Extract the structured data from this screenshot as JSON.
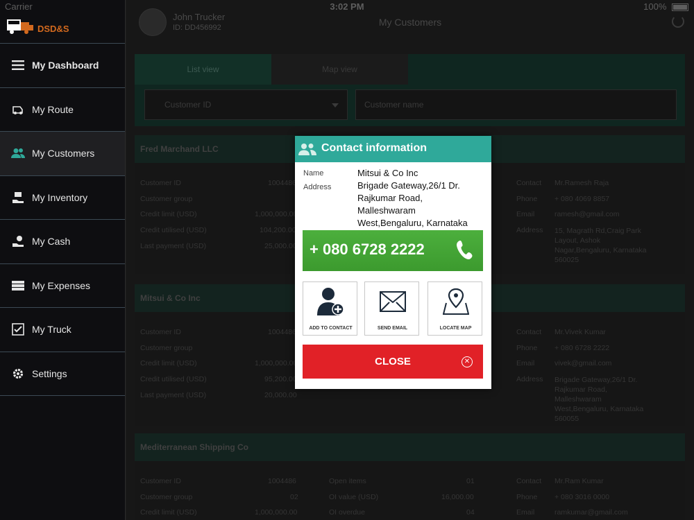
{
  "status_bar": {
    "carrier": "Carrier",
    "time": "3:02 PM",
    "battery": "100%"
  },
  "brand": {
    "name": "DSD&S"
  },
  "sidebar": {
    "items": [
      {
        "label": "My Dashboard",
        "icon": "menu-icon"
      },
      {
        "label": "My Route",
        "icon": "route-icon"
      },
      {
        "label": "My Customers",
        "icon": "customers-icon",
        "active": true
      },
      {
        "label": "My Inventory",
        "icon": "inventory-icon"
      },
      {
        "label": "My Cash",
        "icon": "cash-icon"
      },
      {
        "label": "My Expenses",
        "icon": "expenses-icon"
      },
      {
        "label": "My Truck",
        "icon": "truck-check-icon"
      },
      {
        "label": "Settings",
        "icon": "gear-icon"
      }
    ]
  },
  "header": {
    "user_name": "John Trucker",
    "user_id": "ID: DD456992",
    "title": "My Customers"
  },
  "tabs": [
    {
      "label": "List view"
    },
    {
      "label": "Map view"
    }
  ],
  "filters": {
    "select_placeholder": "Customer ID",
    "search_placeholder": "Customer name"
  },
  "customers": [
    {
      "name": "Fred Marchand LLC",
      "col1": [
        {
          "k": "Customer ID",
          "v": "1004486"
        },
        {
          "k": "Customer group",
          "v": "02"
        },
        {
          "k": "Credit limit (USD)",
          "v": "1,000,000.00"
        },
        {
          "k": "Credit utilised (USD)",
          "v": "104,200.00"
        },
        {
          "k": "Last payment (USD)",
          "v": "25,000.00"
        }
      ],
      "col3": [
        {
          "k": "Contact",
          "v": "Mr.Ramesh Raja"
        },
        {
          "k": "Phone",
          "v": "+ 080 4069 8857"
        },
        {
          "k": "Email",
          "v": "ramesh@gmail.com"
        },
        {
          "k": "Address",
          "v": "15, Magrath Rd,Craig Park Layout, Ashok Nagar,Bengaluru, Karnataka 560025"
        }
      ]
    },
    {
      "name": "Mitsui & Co Inc",
      "col1": [
        {
          "k": "Customer ID",
          "v": "1004486"
        },
        {
          "k": "Customer group",
          "v": "02"
        },
        {
          "k": "Credit limit (USD)",
          "v": "1,000,000.00"
        },
        {
          "k": "Credit utilised (USD)",
          "v": "95,200.00"
        },
        {
          "k": "Last payment (USD)",
          "v": "20,000.00"
        }
      ],
      "col3": [
        {
          "k": "Contact",
          "v": "Mr.Vivek Kumar"
        },
        {
          "k": "Phone",
          "v": "+ 080 6728 2222"
        },
        {
          "k": "Email",
          "v": "vivek@gmail.com"
        },
        {
          "k": "Address",
          "v": "Brigade Gateway,26/1 Dr. Rajkumar Road, Malleshwaram West,Bengaluru, Karnataka 560055"
        }
      ]
    },
    {
      "name": "Mediterranean Shipping Co",
      "col1": [
        {
          "k": "Customer ID",
          "v": "1004486"
        },
        {
          "k": "Customer group",
          "v": "02"
        },
        {
          "k": "Credit limit (USD)",
          "v": "1,000,000.00"
        }
      ],
      "col2": [
        {
          "k": "Open items",
          "v": "01"
        },
        {
          "k": "OI value (USD)",
          "v": "16,000.00"
        },
        {
          "k": "OI overdue",
          "v": "04"
        }
      ],
      "col3": [
        {
          "k": "Contact",
          "v": "Mr.Ram Kumar"
        },
        {
          "k": "Phone",
          "v": "+ 080 3016 0000"
        },
        {
          "k": "Email",
          "v": "ramkumar@gmail.com"
        }
      ]
    }
  ],
  "modal": {
    "title": "Contact information",
    "name_label": "Name",
    "name_value": "Mitsui & Co Inc",
    "address_label": "Address",
    "address_lines": [
      "Brigade Gateway,26/1 Dr.",
      "Rajkumar Road,",
      "Malleshwaram",
      "West,Bengaluru, Karnataka"
    ],
    "phone": "+ 080 6728 2222",
    "actions": [
      {
        "label": "ADD TO CONTACT",
        "icon": "add-contact-icon"
      },
      {
        "label": "SEND EMAIL",
        "icon": "envelope-icon"
      },
      {
        "label": "LOCATE MAP",
        "icon": "map-pin-icon"
      }
    ],
    "close_label": "CLOSE",
    "colors": {
      "header": "#2fa99a",
      "call": "#3c9a2e",
      "close": "#e12127"
    }
  }
}
